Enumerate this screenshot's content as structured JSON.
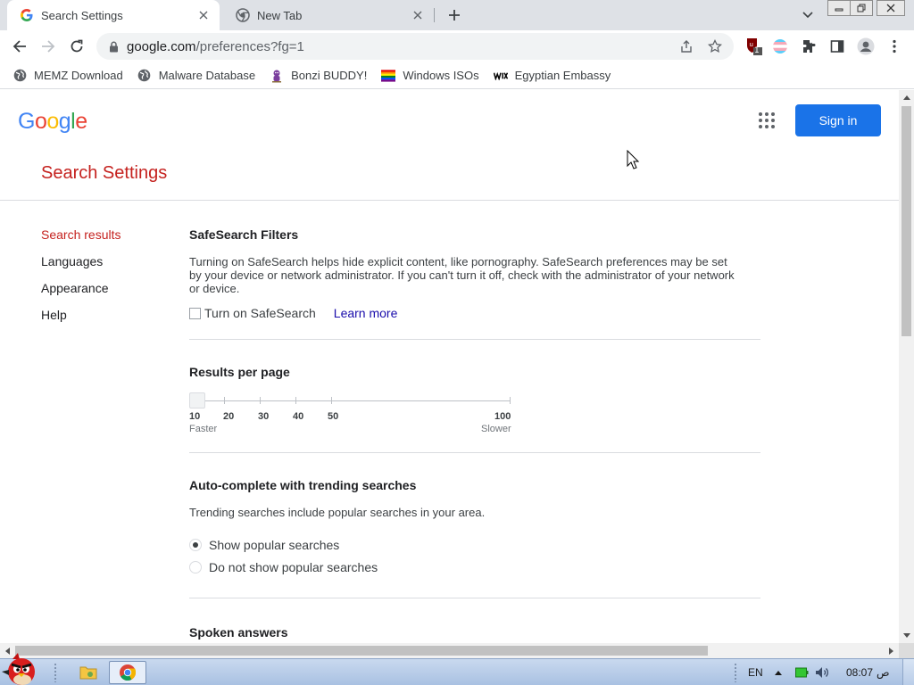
{
  "tabs": [
    {
      "title": "Search Settings",
      "active": true,
      "icon": "google-g-icon"
    },
    {
      "title": "New Tab",
      "active": false,
      "icon": "chrome-icon"
    }
  ],
  "address_bar": {
    "host": "google.com",
    "path": "/preferences?fg=1"
  },
  "extensions": {
    "ublock_badge": "1"
  },
  "bookmarks": [
    {
      "label": "MEMZ Download",
      "icon": "globe-icon"
    },
    {
      "label": "Malware Database",
      "icon": "globe-icon"
    },
    {
      "label": "Bonzi BUDDY!",
      "icon": "bonzi-icon"
    },
    {
      "label": "Windows ISOs",
      "icon": "rainbow-flag-icon"
    },
    {
      "label": "Egyptian Embassy",
      "icon": "wix-icon"
    }
  ],
  "google": {
    "logo_letters": [
      "G",
      "o",
      "o",
      "g",
      "l",
      "e"
    ],
    "logo_colors": [
      "#4285F4",
      "#EA4335",
      "#FBBC05",
      "#4285F4",
      "#34A853",
      "#EA4335"
    ],
    "sign_in": "Sign in",
    "page_title": "Search Settings"
  },
  "sidenav": [
    "Search results",
    "Languages",
    "Appearance",
    "Help"
  ],
  "safesearch": {
    "title": "SafeSearch Filters",
    "desc_lines": [
      "Turning on SafeSearch helps hide explicit content, like pornography. SafeSearch preferences may be set",
      "by your device or network administrator. If you can't turn it off, check with the administrator of your network",
      "or device."
    ],
    "checkbox_label": "Turn on SafeSearch",
    "checked": false,
    "learn_more": "Learn more"
  },
  "results_per_page": {
    "title": "Results per page",
    "ticks": [
      "10",
      "20",
      "30",
      "40",
      "50",
      "100"
    ],
    "selected": "10",
    "faster": "Faster",
    "slower": "Slower"
  },
  "autocomplete": {
    "title": "Auto-complete with trending searches",
    "desc": "Trending searches include popular searches in your area.",
    "options": [
      {
        "label": "Show popular searches",
        "checked": true
      },
      {
        "label": "Do not show popular searches",
        "checked": false
      }
    ]
  },
  "spoken": {
    "title": "Spoken answers"
  },
  "taskbar": {
    "lang": "EN",
    "time": "08:07",
    "ampm": "ص"
  },
  "colors": {
    "accent_red": "#C5221F",
    "accent_blue": "#1A73E8",
    "link": "#1A0DAB"
  }
}
